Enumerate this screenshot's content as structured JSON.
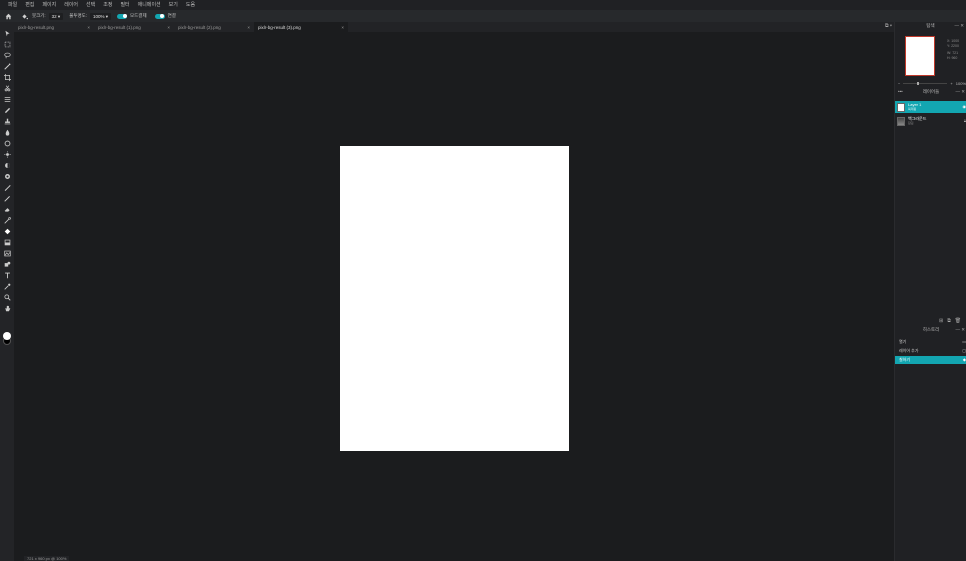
{
  "menu": [
    "파일",
    "편집",
    "페이지",
    "레이어",
    "선택",
    "조정",
    "필터",
    "애니메이션",
    "보기",
    "도움"
  ],
  "options": {
    "brush_label": "붓크기:",
    "brush_value": "32 ▾",
    "opacity_label": "불투명도:",
    "opacity_value": "100% ▾",
    "toggle1_label": "모드결제",
    "toggle2_label": "연결"
  },
  "tabs": [
    {
      "label": "pixlr-bg-result.png",
      "active": false
    },
    {
      "label": "pixlr-bg-result (1).png",
      "active": false
    },
    {
      "label": "pixlr-bg-result (2).png",
      "active": false
    },
    {
      "label": "pixlr-bg-result (3).png",
      "active": true
    }
  ],
  "status": "721 x 960 px @ 100%",
  "navigator": {
    "title": "탐색",
    "x_label": "X:",
    "x_value": "1000",
    "y_label": "Y:",
    "y_value": "2200",
    "w_label": "W:",
    "w_value": "721",
    "h_label": "H:",
    "h_value": "960",
    "zoom_minus": "−",
    "zoom_plus": "+",
    "zoom_value": "100%"
  },
  "layers": {
    "title": "레이어들",
    "items": [
      {
        "name": "Layer 1",
        "sub": "복제됨",
        "selected": true
      },
      {
        "name": "백그라운드",
        "sub": "잠김",
        "selected": false
      }
    ]
  },
  "history": {
    "title": "히스토리",
    "items": [
      {
        "label": "열기",
        "selected": false
      },
      {
        "label": "레이어 추가",
        "selected": false
      },
      {
        "label": "칠하기",
        "selected": true
      }
    ]
  },
  "colors": {
    "accent": "#13a6b1",
    "canvas_bg": "#1b1c1e",
    "document": "#ffffff"
  }
}
